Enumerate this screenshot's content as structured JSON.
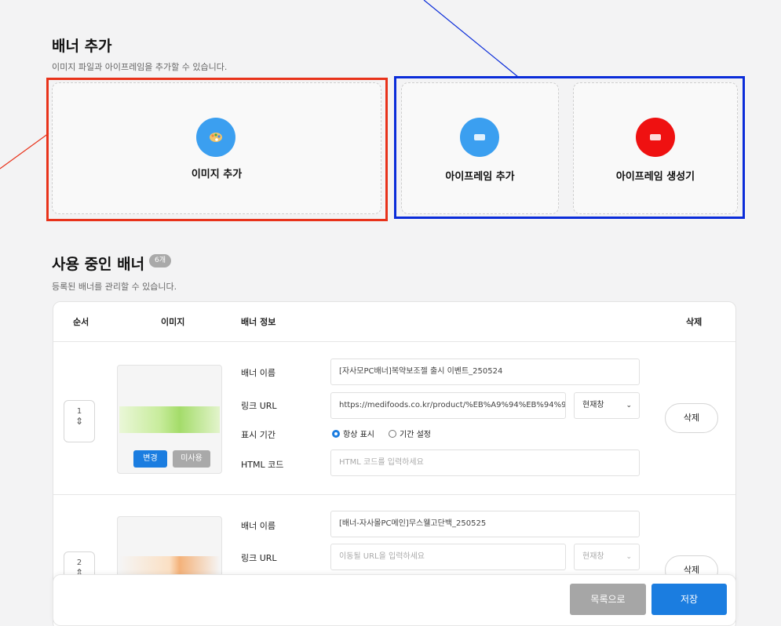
{
  "colors": {
    "accent": "#1b7de0",
    "red_frame": "#e8321a",
    "blue_frame": "#0a2cd9",
    "badge": "#a9a9a9"
  },
  "add_section": {
    "title": "배너 추가",
    "subtitle": "이미지 파일과 아이프레임을 추가할 수 있습니다.",
    "cards": [
      {
        "label": "이미지 추가",
        "icon": "palette-icon",
        "color": "#3b9ff0"
      },
      {
        "label": "아이프레임 추가",
        "icon": "frame-icon",
        "color": "#3b9ff0"
      },
      {
        "label": "아이프레임 생성기",
        "icon": "frame-icon",
        "color": "#ef1111"
      }
    ]
  },
  "active_section": {
    "title": "사용 중인 배너",
    "badge": "6개",
    "subtitle": "등록된 배너를 관리할 수 있습니다."
  },
  "table": {
    "headers": {
      "order": "순서",
      "image": "이미지",
      "info": "배너 정보",
      "delete": "삭제"
    },
    "field_labels": {
      "name": "배너 이름",
      "link": "링크 URL",
      "period": "표시 기간",
      "html": "HTML 코드"
    },
    "rows": [
      {
        "order": "1",
        "name": "[자사모PC배너]복약보조젤 출시 이벤트_250524",
        "link": "https://medifoods.co.kr/product/%EB%A9%94%EB%94%94",
        "target": "현재창",
        "period_always": "항상 표시",
        "period_custom": "기간 설정",
        "html_placeholder": "HTML 코드를 입력하세요",
        "change_btn": "변경",
        "unused_btn": "미사용",
        "delete_btn": "삭제"
      },
      {
        "order": "2",
        "name": "[배너-자사몰PC메인]무스웰고단백_250525",
        "link_placeholder": "이동될 URL을 입력하세요",
        "target": "현재창",
        "delete_btn": "삭제"
      }
    ]
  },
  "footer": {
    "list_btn": "목록으로",
    "save_btn": "저장"
  }
}
